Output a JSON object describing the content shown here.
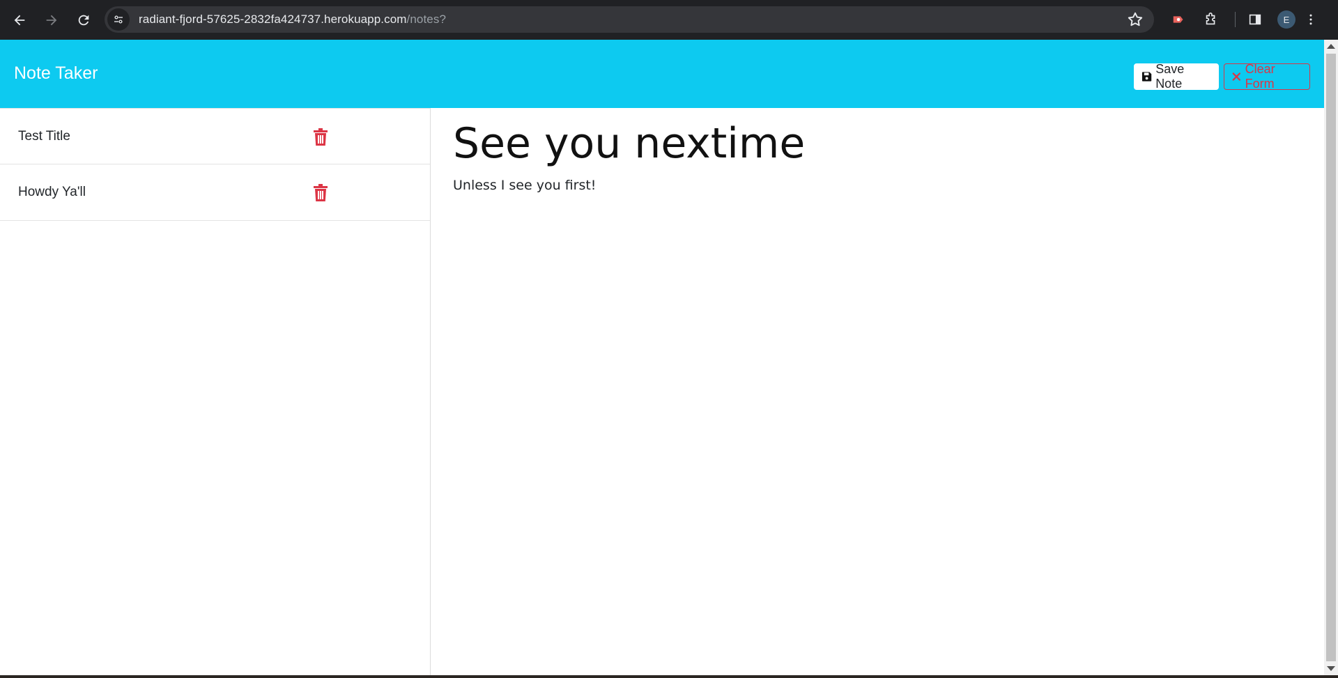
{
  "browser": {
    "url_host": "radiant-fjord-57625-2832fa424737.herokuapp.com",
    "url_path": "/notes?",
    "profile_initial": "E"
  },
  "app": {
    "brand": "Note Taker",
    "save_label": "Save Note",
    "clear_label": "Clear Form",
    "accent_color": "#0dcaf0",
    "danger_color": "#dc3545"
  },
  "notes": [
    {
      "title": "Test Title"
    },
    {
      "title": "Howdy Ya'll"
    }
  ],
  "active_note": {
    "title": "See you nextime",
    "text": "Unless I see you first!"
  }
}
